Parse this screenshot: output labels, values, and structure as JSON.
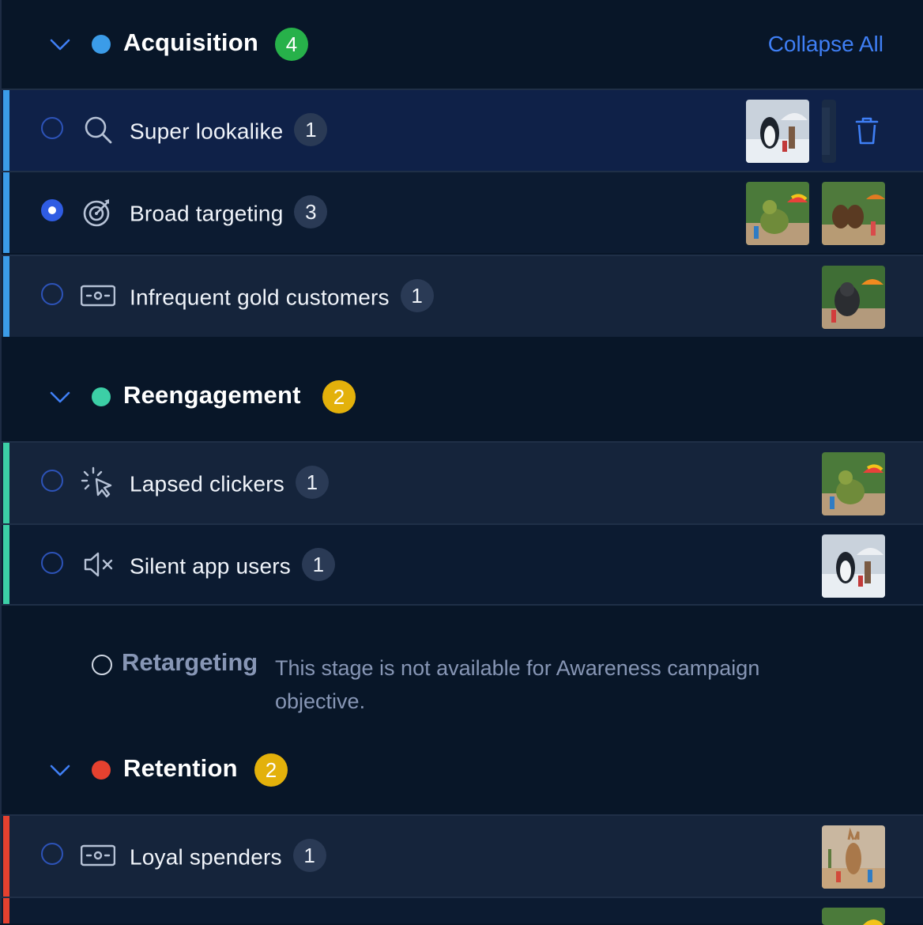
{
  "stages": [
    {
      "name": "Acquisition",
      "count": "4",
      "dot_color": "#3b9ce8",
      "badge_color": "#27b14a",
      "rows": [
        {
          "label": "Super lookalike",
          "count": "1",
          "icon": "search-icon",
          "selected": false
        },
        {
          "label": "Broad targeting",
          "count": "3",
          "icon": "target-icon",
          "selected": true
        },
        {
          "label": "Infrequent gold customers",
          "count": "1",
          "icon": "ticket-icon",
          "selected": false
        }
      ]
    },
    {
      "name": "Reengagement",
      "count": "2",
      "dot_color": "#3ccfa6",
      "badge_color": "#e3b10b",
      "rows": [
        {
          "label": "Lapsed clickers",
          "count": "1",
          "icon": "cursor-click-icon",
          "selected": false
        },
        {
          "label": "Silent app users",
          "count": "1",
          "icon": "mute-icon",
          "selected": false
        }
      ]
    },
    {
      "name": "Retention",
      "count": "2",
      "dot_color": "#e5412f",
      "badge_color": "#e3b10b",
      "rows": [
        {
          "label": "Loyal spenders",
          "count": "1",
          "icon": "ticket-icon",
          "selected": false
        }
      ]
    }
  ],
  "collapse_all": "Collapse All",
  "retargeting": {
    "name": "Retargeting",
    "note": "This stage is not available for Awareness campaign objective."
  }
}
